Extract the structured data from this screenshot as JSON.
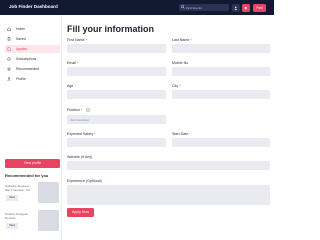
{
  "app": {
    "title": "Job Finder Dashboard"
  },
  "topbar": {
    "search_placeholder": "Find Events",
    "post_label": "Post"
  },
  "colors": {
    "brand_dark": "#121a33",
    "accent": "#e8435f",
    "input_bg": "#e9ebf0"
  },
  "sidebar": {
    "items": [
      {
        "label": "Home",
        "icon": "home-icon"
      },
      {
        "label": "Saved",
        "icon": "bookmark-icon"
      },
      {
        "label": "Applied",
        "icon": "file-icon",
        "active": true
      },
      {
        "label": "Subscriptions",
        "icon": "bell-icon"
      },
      {
        "label": "Recommended",
        "icon": "star-icon"
      },
      {
        "label": "Profile",
        "icon": "user-icon"
      }
    ],
    "view_profile_label": "View profile",
    "recommended_title": "Recommended for you",
    "recommended": [
      {
        "line1": "Software Engineer",
        "line2": "San Francisco, CA",
        "view_label": "View"
      },
      {
        "line1": "Product Designer",
        "line2": "Remote",
        "view_label": "View"
      }
    ]
  },
  "form": {
    "title": "Fill your information",
    "first_name": "First Name",
    "last_name": "Last Name",
    "email": "Email",
    "mobile": "Mobile No",
    "age": "Age",
    "city": "City",
    "position": "Position",
    "position_placeholder": "Web Developer",
    "expected_salary": "Expected Salary",
    "start_date": "Start Date",
    "website": "Website (If Any)",
    "experience": "Experience (Optional)",
    "apply_label": "Apply Now",
    "required_mark": "*"
  }
}
